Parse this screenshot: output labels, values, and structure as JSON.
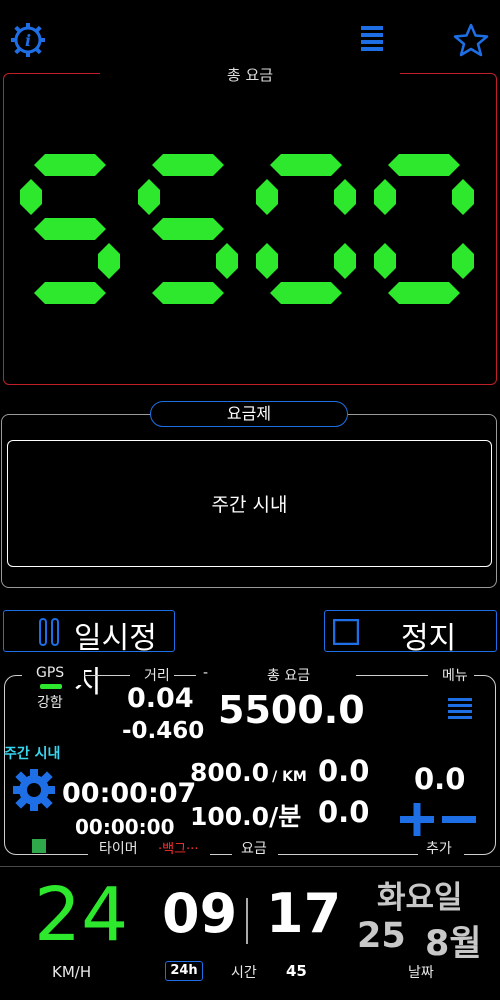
{
  "top_bar": {
    "info_icon": "info-gear-icon",
    "menu_icon": "hamburger-icon",
    "favorite_icon": "star-icon"
  },
  "fare_panel": {
    "title": "총 요금",
    "amount": "5500"
  },
  "rate_panel": {
    "badge": "요금제",
    "rate_name": "주간 시내"
  },
  "buttons": {
    "pause_label": "일시정지",
    "stop_label": "정지"
  },
  "info_panel": {
    "gps_label": "GPS",
    "gps_strength": "강함",
    "distance_label": "거리",
    "dash": "-",
    "total_fare_label": "총 요금",
    "menu_label": "메뉴",
    "distance_value": "0.04",
    "distance_delta": "-0.460",
    "total_fare_value": "5500.0",
    "rate_tag": "주간 시내",
    "elapsed_time": "00:00:07",
    "idle_time": "00:00:00",
    "per_km_rate": "800.0",
    "per_km_unit": "/ KM",
    "per_km_amount": "0.0",
    "per_min_rate": "100.0/분",
    "per_min_amount": "0.0",
    "extra_amount": "0.0",
    "timer_label": "타이머",
    "background_label": "·백그···",
    "fare_label": "요금",
    "add_label": "추가"
  },
  "bottom_bar": {
    "speed": "24",
    "speed_unit": "KM/H",
    "hour": "09",
    "minute": "17",
    "format_badge": "24h",
    "time_label": "시간",
    "seconds": "45",
    "weekday": "화요일",
    "day": "25",
    "month": "8월",
    "date_label": "날짜"
  },
  "colors": {
    "accent_blue": "#1e6fe6",
    "segment_green": "#2ee82e",
    "fare_border_red": "#c0202a",
    "cyan": "#38d6f0",
    "warning_red": "#ff3030"
  }
}
